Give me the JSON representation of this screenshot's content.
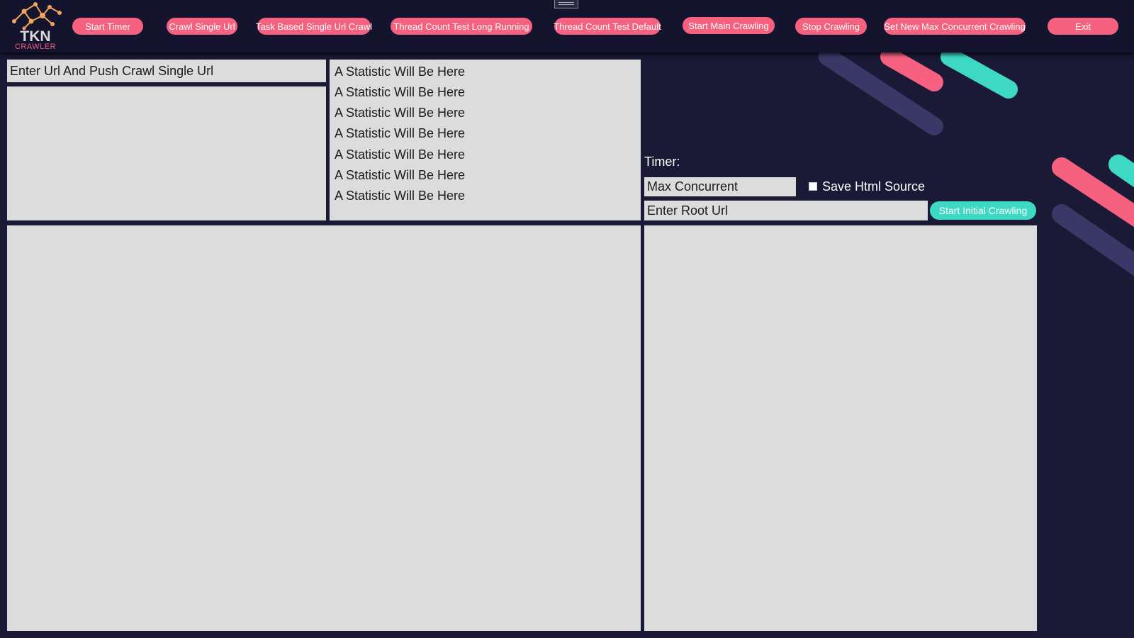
{
  "app": {
    "logo_text": "TKN",
    "logo_subtext": "CRAWLER"
  },
  "toolbar": {
    "buttons": [
      {
        "label": "Start Timer"
      },
      {
        "label": "Crawl Single Url"
      },
      {
        "label": "Task Based Single Url Crawl"
      },
      {
        "label": "Thread Count Test Long Running"
      },
      {
        "label": "Thread Count Test Default"
      },
      {
        "label": "Start Main Crawling"
      },
      {
        "label": "Stop Crawling"
      },
      {
        "label": "Set New Max Concurrent Crawling"
      },
      {
        "label": "Exit"
      }
    ]
  },
  "single_url": {
    "placeholder": "Enter Url And Push Crawl Single Url"
  },
  "statistics": [
    "A Statistic Will Be Here",
    "A Statistic Will Be Here",
    "A Statistic Will Be Here",
    "A Statistic Will Be Here",
    "A Statistic Will Be Here",
    "A Statistic Will Be Here",
    "A Statistic Will Be Here"
  ],
  "controls": {
    "timer_label": "Timer:",
    "max_concurrent_placeholder": "Max Concurrent",
    "save_html_label": "Save Html Source",
    "save_html_checked": false,
    "root_url_placeholder": "Enter Root Url",
    "start_initial_label": "Start Initial Crawling"
  },
  "colors": {
    "background": "#1a1936",
    "topbar": "#15142e",
    "accent_pink": "#f5617f",
    "accent_teal": "#3dd9c5",
    "decor_purple": "#3a3866",
    "panel": "#dcdcdc"
  }
}
